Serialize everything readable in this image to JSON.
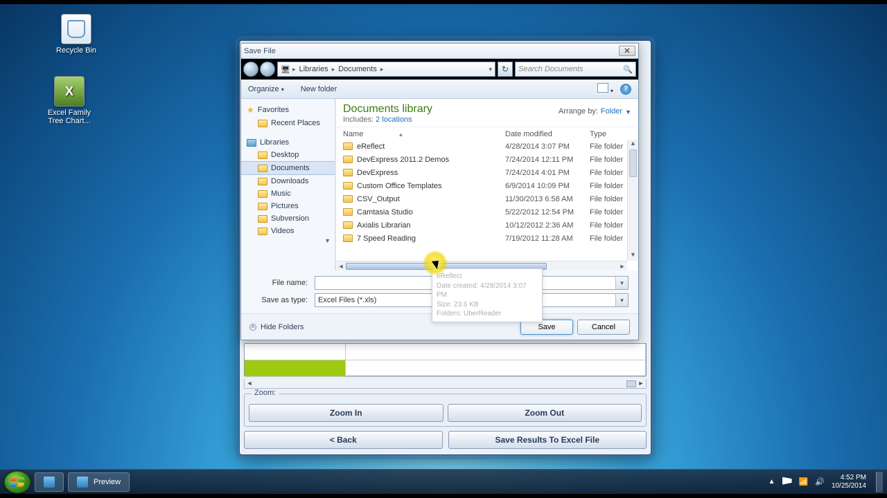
{
  "desktop": {
    "recycle_bin": "Recycle Bin",
    "excel_app": "Excel Family\nTree Chart..."
  },
  "app": {
    "zoom_label": "Zoom:",
    "zoom_in": "Zoom In",
    "zoom_out": "Zoom Out",
    "back": "< Back",
    "save_excel": "Save Results To Excel File"
  },
  "dialog": {
    "title": "Save File",
    "breadcrumb": {
      "seg1": "Libraries",
      "seg2": "Documents"
    },
    "search_placeholder": "Search Documents",
    "organize": "Organize",
    "new_folder": "New folder",
    "lib_title": "Documents library",
    "includes_label": "Includes:",
    "includes_link": "2 locations",
    "arrange_label": "Arrange by:",
    "arrange_value": "Folder",
    "cols": {
      "name": "Name",
      "date": "Date modified",
      "type": "Type"
    },
    "filename_label": "File name:",
    "filename_value": "",
    "savetype_label": "Save as type:",
    "savetype_value": "Excel Files (*.xls)",
    "hide_folders": "Hide Folders",
    "save": "Save",
    "cancel": "Cancel"
  },
  "nav": {
    "favorites": "Favorites",
    "recent": "Recent Places",
    "libraries": "Libraries",
    "items": [
      "Desktop",
      "Documents",
      "Downloads",
      "Music",
      "Pictures",
      "Subversion",
      "Videos"
    ]
  },
  "files": [
    {
      "name": "7 Speed Reading",
      "date": "7/19/2012 11:28 AM",
      "type": "File folder"
    },
    {
      "name": "Axialis Librarian",
      "date": "10/12/2012 2:36 AM",
      "type": "File folder"
    },
    {
      "name": "Camtasia Studio",
      "date": "5/22/2012 12:54 PM",
      "type": "File folder"
    },
    {
      "name": "CSV_Output",
      "date": "11/30/2013 6:58 AM",
      "type": "File folder"
    },
    {
      "name": "Custom Office Templates",
      "date": "6/9/2014 10:09 PM",
      "type": "File folder"
    },
    {
      "name": "DevExpress",
      "date": "7/24/2014 4:01 PM",
      "type": "File folder"
    },
    {
      "name": "DevExpress 2011.2 Demos",
      "date": "7/24/2014 12:11 PM",
      "type": "File folder"
    },
    {
      "name": "eReflect",
      "date": "4/28/2014 3:07 PM",
      "type": "File folder"
    }
  ],
  "tooltip": {
    "name": "eReflect",
    "created": "Date created: 4/28/2014 3:07 PM",
    "size": "Size: 23.6 KB",
    "folders": "Folders: UberReader"
  },
  "taskbar": {
    "preview": "Preview",
    "time": "4:52 PM",
    "date": "10/25/2014"
  }
}
